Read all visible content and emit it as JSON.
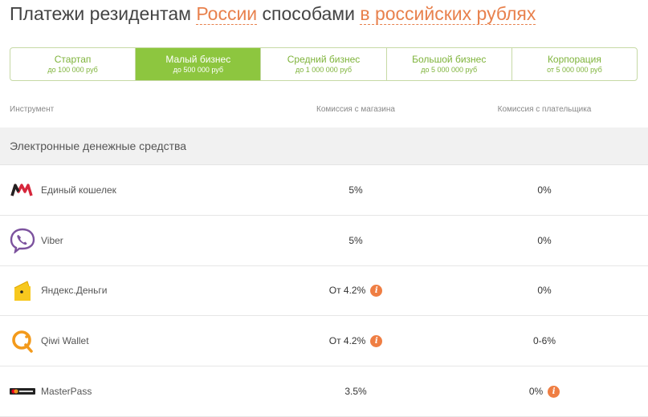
{
  "title": {
    "part1": "Платежи резидентам ",
    "link1": "России",
    "part2": " способами ",
    "link2": "в российских рублях"
  },
  "tabs": [
    {
      "name": "Стартап",
      "sub": "до 100 000 руб",
      "active": false
    },
    {
      "name": "Малый бизнес",
      "sub": "до 500 000 руб",
      "active": true
    },
    {
      "name": "Средний бизнес",
      "sub": "до 1 000 000 руб",
      "active": false
    },
    {
      "name": "Большой бизнес",
      "sub": "до 5 000 000 руб",
      "active": false
    },
    {
      "name": "Корпорация",
      "sub": "от 5 000 000 руб",
      "active": false
    }
  ],
  "table": {
    "col_instrument": "Инструмент",
    "col_shop": "Комиссия с магазина",
    "col_payer": "Комиссия с плательщика",
    "group": "Электронные денежные средства",
    "rows": [
      {
        "name": "Единый кошелек",
        "icon": "w1-wallet-icon",
        "shop": "5%",
        "shop_info": false,
        "payer": "0%",
        "payer_info": false
      },
      {
        "name": "Viber",
        "icon": "viber-icon",
        "shop": "5%",
        "shop_info": false,
        "payer": "0%",
        "payer_info": false
      },
      {
        "name": "Яндекс.Деньги",
        "icon": "yandex-money-icon",
        "shop": "От 4.2%",
        "shop_info": true,
        "payer": "0%",
        "payer_info": false
      },
      {
        "name": "Qiwi Wallet",
        "icon": "qiwi-icon",
        "shop": "От 4.2%",
        "shop_info": true,
        "payer": "0-6%",
        "payer_info": false
      },
      {
        "name": "MasterPass",
        "icon": "masterpass-icon",
        "shop": "3.5%",
        "shop_info": false,
        "payer": "0%",
        "payer_info": true
      }
    ]
  },
  "info_glyph": "i",
  "colors": {
    "accent_green": "#8dc63f",
    "link_orange": "#e8814d",
    "info_orange": "#ef7e43"
  }
}
